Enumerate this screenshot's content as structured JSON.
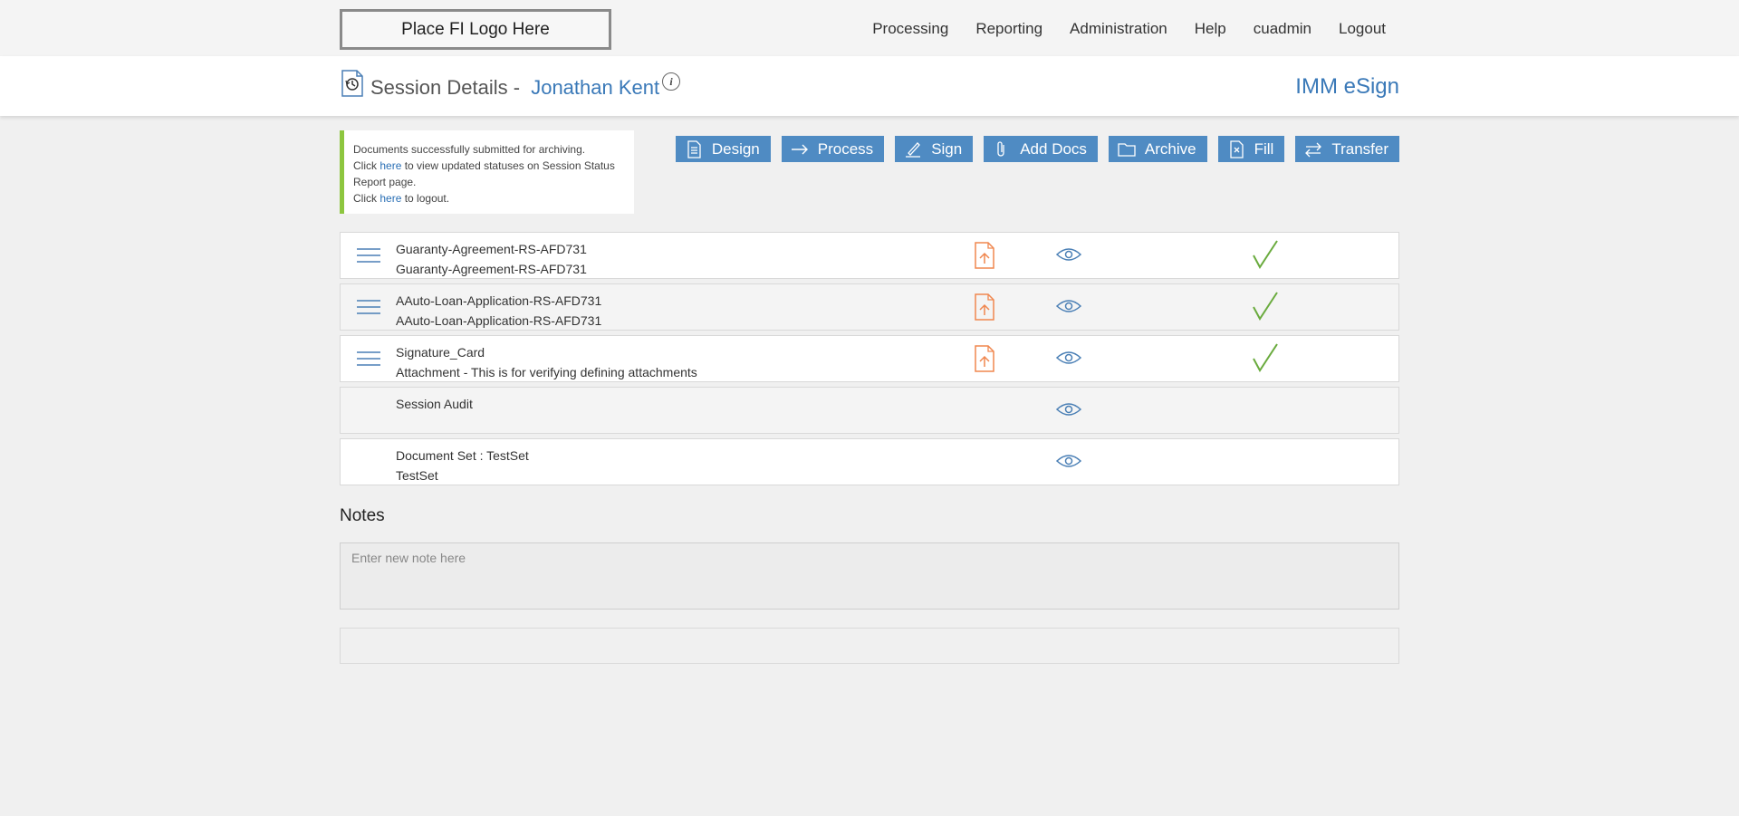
{
  "logo": {
    "text": "Place FI Logo Here"
  },
  "nav": {
    "items": [
      {
        "label": "Processing"
      },
      {
        "label": "Reporting"
      },
      {
        "label": "Administration"
      },
      {
        "label": "Help"
      },
      {
        "label": "cuadmin"
      },
      {
        "label": "Logout"
      }
    ]
  },
  "header": {
    "title": "Session Details -",
    "name": "Jonathan Kent",
    "info_glyph": "i",
    "brand": "IMM eSign"
  },
  "alert": {
    "line1": "Documents successfully submitted for archiving.",
    "line2_pre": "Click ",
    "line2_link": "here",
    "line2_post": " to view updated statuses on Session Status Report page.",
    "line3_pre": "Click ",
    "line3_link": "here",
    "line3_post": " to logout."
  },
  "toolbar": {
    "buttons": [
      {
        "label": "Design",
        "icon": "document-list-icon"
      },
      {
        "label": "Process",
        "icon": "arrow-right-icon"
      },
      {
        "label": "Sign",
        "icon": "pen-icon"
      },
      {
        "label": "Add Docs",
        "icon": "paperclip-icon"
      },
      {
        "label": "Archive",
        "icon": "folder-icon"
      },
      {
        "label": "Fill",
        "icon": "form-fill-icon"
      },
      {
        "label": "Transfer",
        "icon": "transfer-arrows-icon"
      }
    ]
  },
  "documents": [
    {
      "line1": "Guaranty-Agreement-RS-AFD731",
      "line2": "Guaranty-Agreement-RS-AFD731",
      "menu": true,
      "upload": true,
      "view": true,
      "complete": true
    },
    {
      "line1": "AAuto-Loan-Application-RS-AFD731",
      "line2": "AAuto-Loan-Application-RS-AFD731",
      "menu": true,
      "upload": true,
      "view": true,
      "complete": true
    },
    {
      "line1": "Signature_Card",
      "line2": "Attachment - This is for verifying defining attachments",
      "menu": true,
      "upload": true,
      "view": true,
      "complete": true
    },
    {
      "line1": "Session Audit",
      "line2": "",
      "menu": false,
      "upload": false,
      "view": true,
      "complete": false
    },
    {
      "line1": "Document Set : TestSet",
      "line2": "TestSet",
      "menu": false,
      "upload": false,
      "view": true,
      "complete": false
    }
  ],
  "notes": {
    "title": "Notes",
    "placeholder": "Enter new note here",
    "value": ""
  },
  "colors": {
    "accent": "#3a79b8",
    "button": "#4f8bc3",
    "upload": "#f0874f",
    "check": "#6aab3e",
    "alert_border": "#8dc63f"
  }
}
